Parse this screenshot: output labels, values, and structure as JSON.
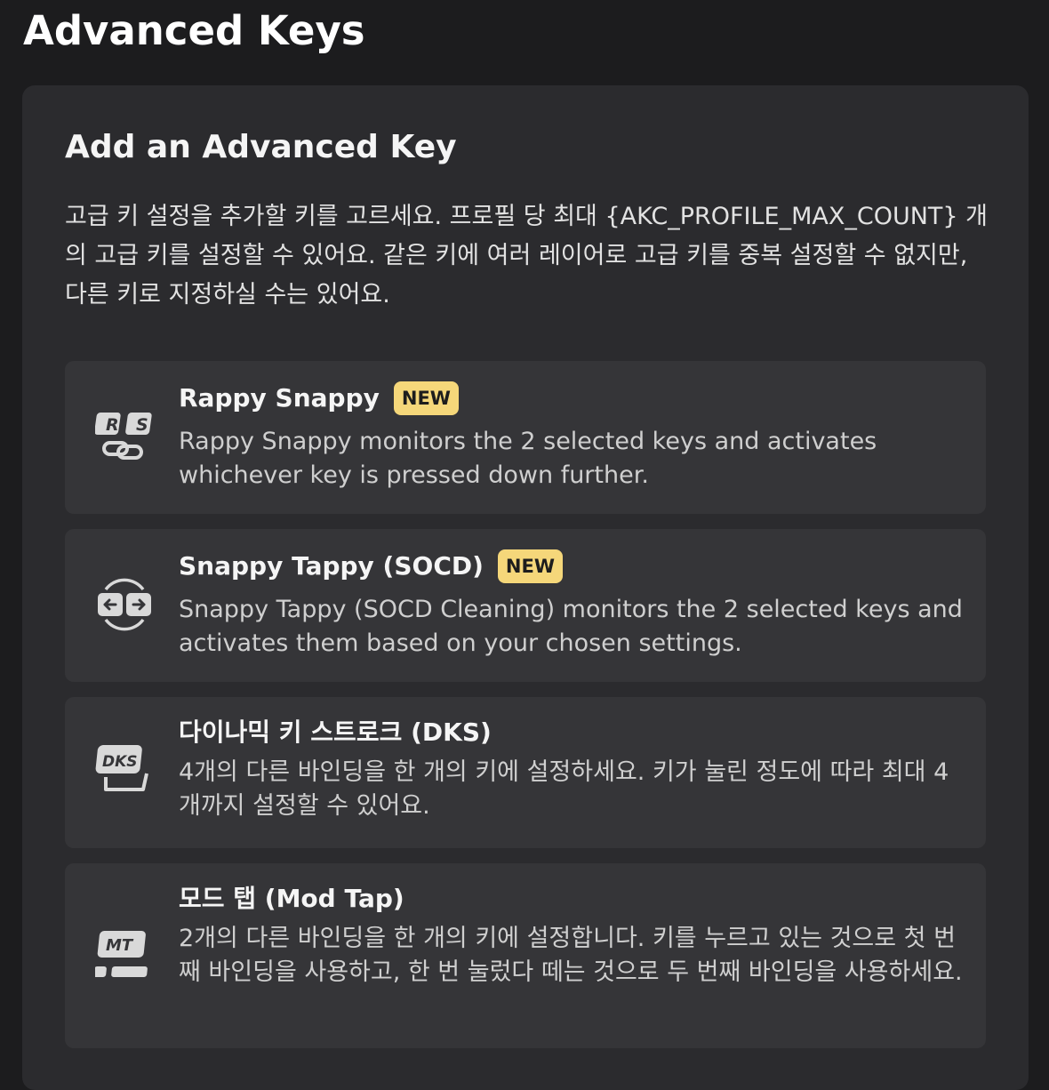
{
  "page": {
    "title": "Advanced Keys"
  },
  "panel": {
    "title": "Add an Advanced Key",
    "description": "고급 키 설정을 추가할 키를 고르세요. 프로필 당 최대 {AKC_PROFILE_MAX_COUNT} 개의 고급 키를 설정할 수 있어요. 같은 키에 여러 레이어로 고급 키를 중복 설정할 수 없지만, 다른 키로 지정하실 수는 있어요."
  },
  "cards": [
    {
      "title": "Rappy Snappy",
      "badge": "NEW",
      "description": "Rappy Snappy monitors the 2 selected keys and activates whichever key is pressed down further.",
      "icon": "rappy-snappy-icon",
      "icon_text_1": "R",
      "icon_text_2": "S"
    },
    {
      "title": "Snappy Tappy (SOCD)",
      "badge": "NEW",
      "description": "Snappy Tappy (SOCD Cleaning) monitors the 2 selected keys and activates them based on your chosen settings.",
      "icon": "snappy-tappy-icon"
    },
    {
      "title": "다이나믹 키 스트로크 (DKS)",
      "badge": "",
      "description": "4개의 다른 바인딩을 한 개의 키에 설정하세요. 키가 눌린 정도에 따라 최대 4개까지 설정할 수 있어요.",
      "icon": "dks-icon",
      "icon_text": "DKS"
    },
    {
      "title": "모드 탭 (Mod Tap)",
      "badge": "",
      "description": "2개의 다른 바인딩을 한 개의 키에 설정합니다. 키를 누르고 있는 것으로 첫 번째 바인딩을 사용하고, 한 번 눌렀다 떼는 것으로 두 번째 바인딩을 사용하세요.",
      "icon": "mod-tap-icon",
      "icon_text": "MT"
    }
  ],
  "colors": {
    "background": "#1c1c1e",
    "panel": "#2b2b2e",
    "card": "#353538",
    "badge": "#f5d77a",
    "icon": "#d9d9d9"
  }
}
